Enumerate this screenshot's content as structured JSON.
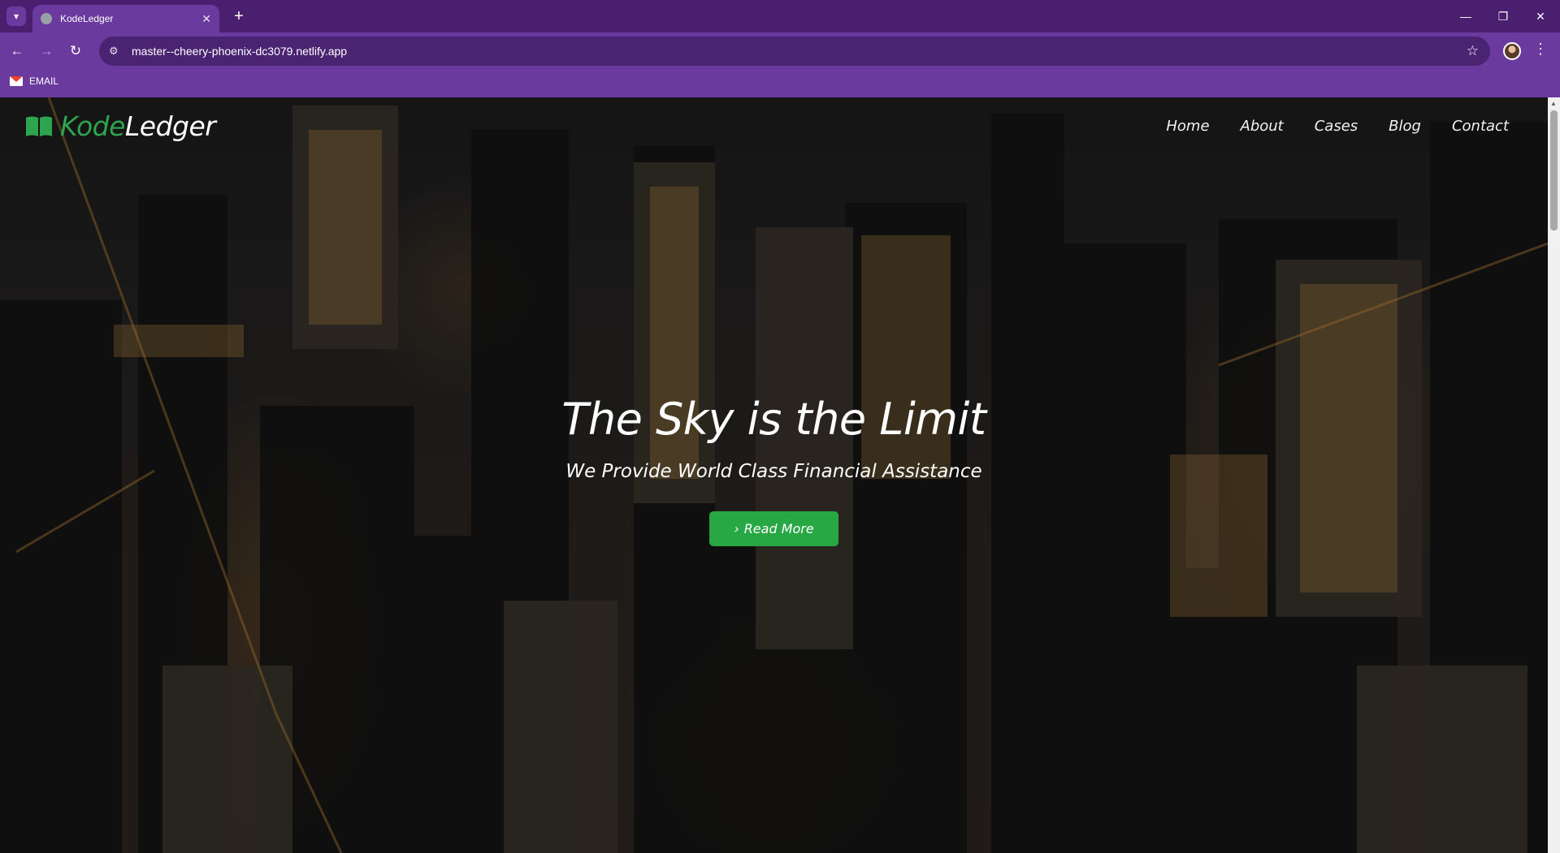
{
  "browser": {
    "tab_title": "KodeLedger",
    "tab_close": "✕",
    "new_tab": "+",
    "url": "master--cheery-phoenix-dc3079.netlify.app",
    "bookmarks": [
      {
        "label": "EMAIL"
      }
    ]
  },
  "site": {
    "brand": {
      "part1": "Kode",
      "part2": "Ledger"
    },
    "nav": [
      {
        "label": "Home"
      },
      {
        "label": "About"
      },
      {
        "label": "Cases"
      },
      {
        "label": "Blog"
      },
      {
        "label": "Contact"
      }
    ],
    "hero": {
      "title": "The Sky is the Limit",
      "subtitle": "We Provide World Class Financial Assistance",
      "cta_label": "Read More"
    }
  },
  "colors": {
    "chrome_purple": "#6a3a9e",
    "brand_green": "#2ea44f",
    "cta_green": "#28a745"
  }
}
